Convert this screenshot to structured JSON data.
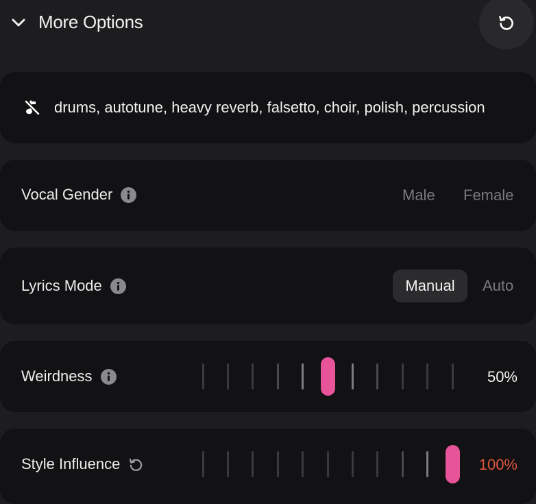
{
  "header": {
    "title": "More Options",
    "chevron_icon": "chevron-down-icon",
    "reset_icon": "reset-icon"
  },
  "exclude": {
    "icon": "music-note-off-icon",
    "text": "drums, autotune, heavy reverb, falsetto, choir, polish, percussion"
  },
  "vocal_gender": {
    "label": "Vocal Gender",
    "options": [
      "Male",
      "Female"
    ],
    "selected": null
  },
  "lyrics_mode": {
    "label": "Lyrics Mode",
    "options": [
      "Manual",
      "Auto"
    ],
    "selected": "Manual"
  },
  "weirdness": {
    "label": "Weirdness",
    "value_text": "50%",
    "value": 0.5,
    "value_color": "#f2f2f2"
  },
  "style_influence": {
    "label": "Style Influence",
    "value_text": "100%",
    "value": 1.0,
    "value_color": "#e0573f"
  },
  "colors": {
    "accent": "#e8549a",
    "background": "#1d1d1f",
    "card": "#121214"
  }
}
